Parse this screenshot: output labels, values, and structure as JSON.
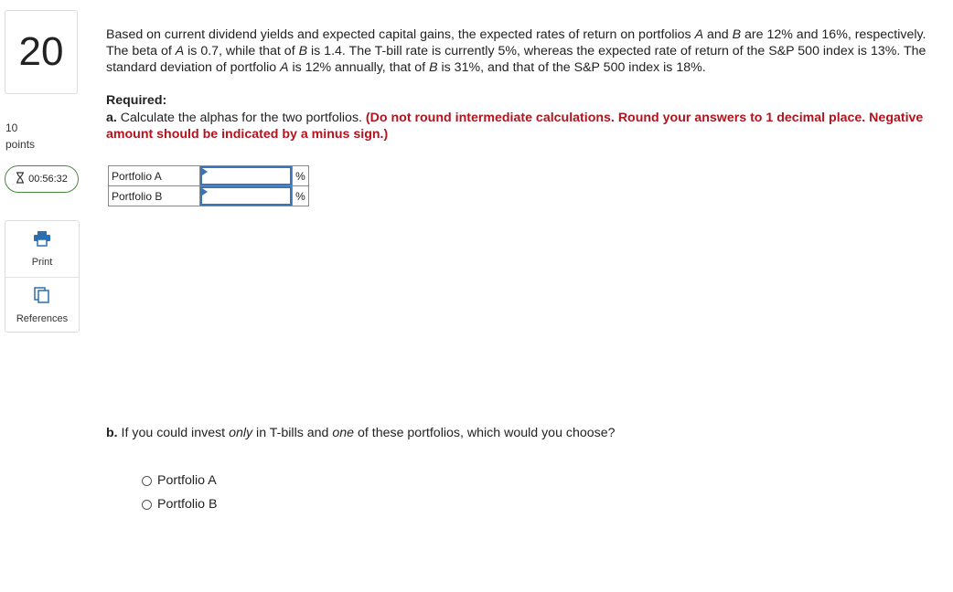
{
  "question": {
    "number": "20",
    "points_value": "10",
    "points_label": "points",
    "timer": "00:56:32",
    "body": {
      "part1": "Based on current dividend yields and expected capital gains, the expected rates of return on portfolios ",
      "var_a1": "A",
      "part2": " and ",
      "var_b1": "B",
      "part3": " are 12% and 16%, respectively. The beta of ",
      "var_a2": "A",
      "part4": " is 0.7, while that of ",
      "var_b2": "B",
      "part5": " is 1.4. The T-bill rate is currently 5%, whereas the expected rate of return of the S&P 500 index is 13%. The standard deviation of portfolio ",
      "var_a3": "A",
      "part6": " is 12% annually, that of ",
      "var_b3": "B",
      "part7": " is 31%, and that of the S&P 500 index is 18%."
    }
  },
  "tools": {
    "print_label": "Print",
    "references_label": "References"
  },
  "required": {
    "title": "Required:",
    "a_prefix": "a.",
    "a_text": " Calculate the alphas for the two portfolios. ",
    "a_instruction": "(Do not round intermediate calculations. Round your answers to 1 decimal place. Negative amount should be indicated by a minus sign.)"
  },
  "answers": {
    "rows": [
      {
        "label": "Portfolio A",
        "value": "",
        "unit": "%"
      },
      {
        "label": "Portfolio B",
        "value": "",
        "unit": "%"
      }
    ]
  },
  "part_b": {
    "prefix": "b.",
    "t1": " If you could invest ",
    "only": "only",
    "t2": " in T-bills and ",
    "one": "one",
    "t3": " of these portfolios, which would you choose?",
    "options": [
      "Portfolio A",
      "Portfolio B"
    ]
  },
  "colors": {
    "accent_blue": "#3a73b7",
    "instruction_red": "#b3131d",
    "timer_green": "#4a8a3c"
  }
}
